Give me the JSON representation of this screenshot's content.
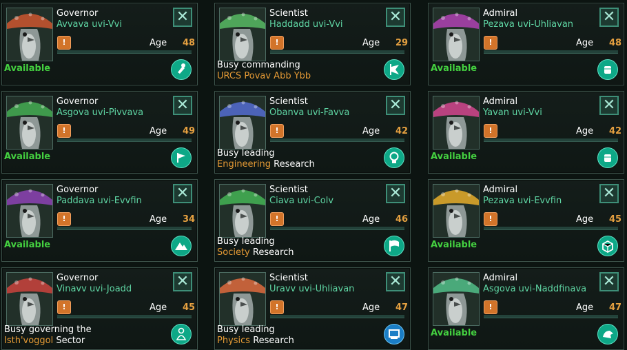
{
  "ui": {
    "close_glyph": "✕",
    "trait_glyph": "!",
    "age_label": "Age"
  },
  "leaders": [
    {
      "role": "Governor",
      "name": "Avvava uvi-Vvi",
      "age": "48",
      "status": {
        "type": "available",
        "text": "Available"
      },
      "icon": "hand-spade-icon",
      "cap": "#b3502e"
    },
    {
      "role": "Governor",
      "name": "Asgova uvi-Pivvava",
      "age": "49",
      "status": {
        "type": "available",
        "text": "Available"
      },
      "icon": "flag-icon",
      "cap": "#3f9a4c"
    },
    {
      "role": "Governor",
      "name": "Paddava uvi-Evvfin",
      "age": "34",
      "status": {
        "type": "available",
        "text": "Available"
      },
      "icon": "mountains-icon",
      "cap": "#7d3fa0"
    },
    {
      "role": "Governor",
      "name": "Vinavv uvi-Joadd",
      "age": "45",
      "status": {
        "type": "busy",
        "line1": "Busy governing the",
        "highlight": "Isth'voggol",
        "rest": " Sector"
      },
      "icon": "robed-figure-icon",
      "cap": "#b2403a"
    },
    {
      "role": "Scientist",
      "name": "Haddadd uvi-Vvi",
      "age": "29",
      "status": {
        "type": "busy",
        "line1": "Busy commanding",
        "highlight": "URCS Povav Abb Ybb",
        "rest": ""
      },
      "icon": "science-ship-icon",
      "cap": "#4fa55a"
    },
    {
      "role": "Scientist",
      "name": "Obanva uvi-Favva",
      "age": "42",
      "status": {
        "type": "busy",
        "line1": "Busy leading",
        "highlight": "Engineering",
        "rest": " Research"
      },
      "icon": "lightbulb-icon",
      "cap": "#4c63b8"
    },
    {
      "role": "Scientist",
      "name": "Ciava uvi-Colv",
      "age": "46",
      "status": {
        "type": "busy",
        "line1": "Busy leading",
        "highlight": "Society",
        "rest": " Research"
      },
      "icon": "society-flag-icon",
      "cap": "#3fa04e"
    },
    {
      "role": "Scientist",
      "name": "Uravv uvi-Uhliavan",
      "age": "47",
      "status": {
        "type": "busy",
        "line1": "Busy leading",
        "highlight": "Physics",
        "rest": " Research"
      },
      "icon": "computer-icon",
      "cap": "#c2613a"
    },
    {
      "role": "Admiral",
      "name": "Pezava uvi-Uhliavan",
      "age": "48",
      "status": {
        "type": "available",
        "text": "Available"
      },
      "icon": "fist-icon",
      "cap": "#9a3f9e"
    },
    {
      "role": "Admiral",
      "name": "Yavan uvi-Vvi",
      "age": "42",
      "status": {
        "type": "available",
        "text": "Available"
      },
      "icon": "fist-icon",
      "cap": "#b9427f"
    },
    {
      "role": "Admiral",
      "name": "Pezava uvi-Evvfin",
      "age": "45",
      "status": {
        "type": "available",
        "text": "Available"
      },
      "icon": "crate-icon",
      "cap": "#c99a2a"
    },
    {
      "role": "Admiral",
      "name": "Asgova uvi-Naddfinava",
      "age": "47",
      "status": {
        "type": "available",
        "text": "Available"
      },
      "icon": "creature-head-icon",
      "cap": "#4aa97a"
    }
  ]
}
